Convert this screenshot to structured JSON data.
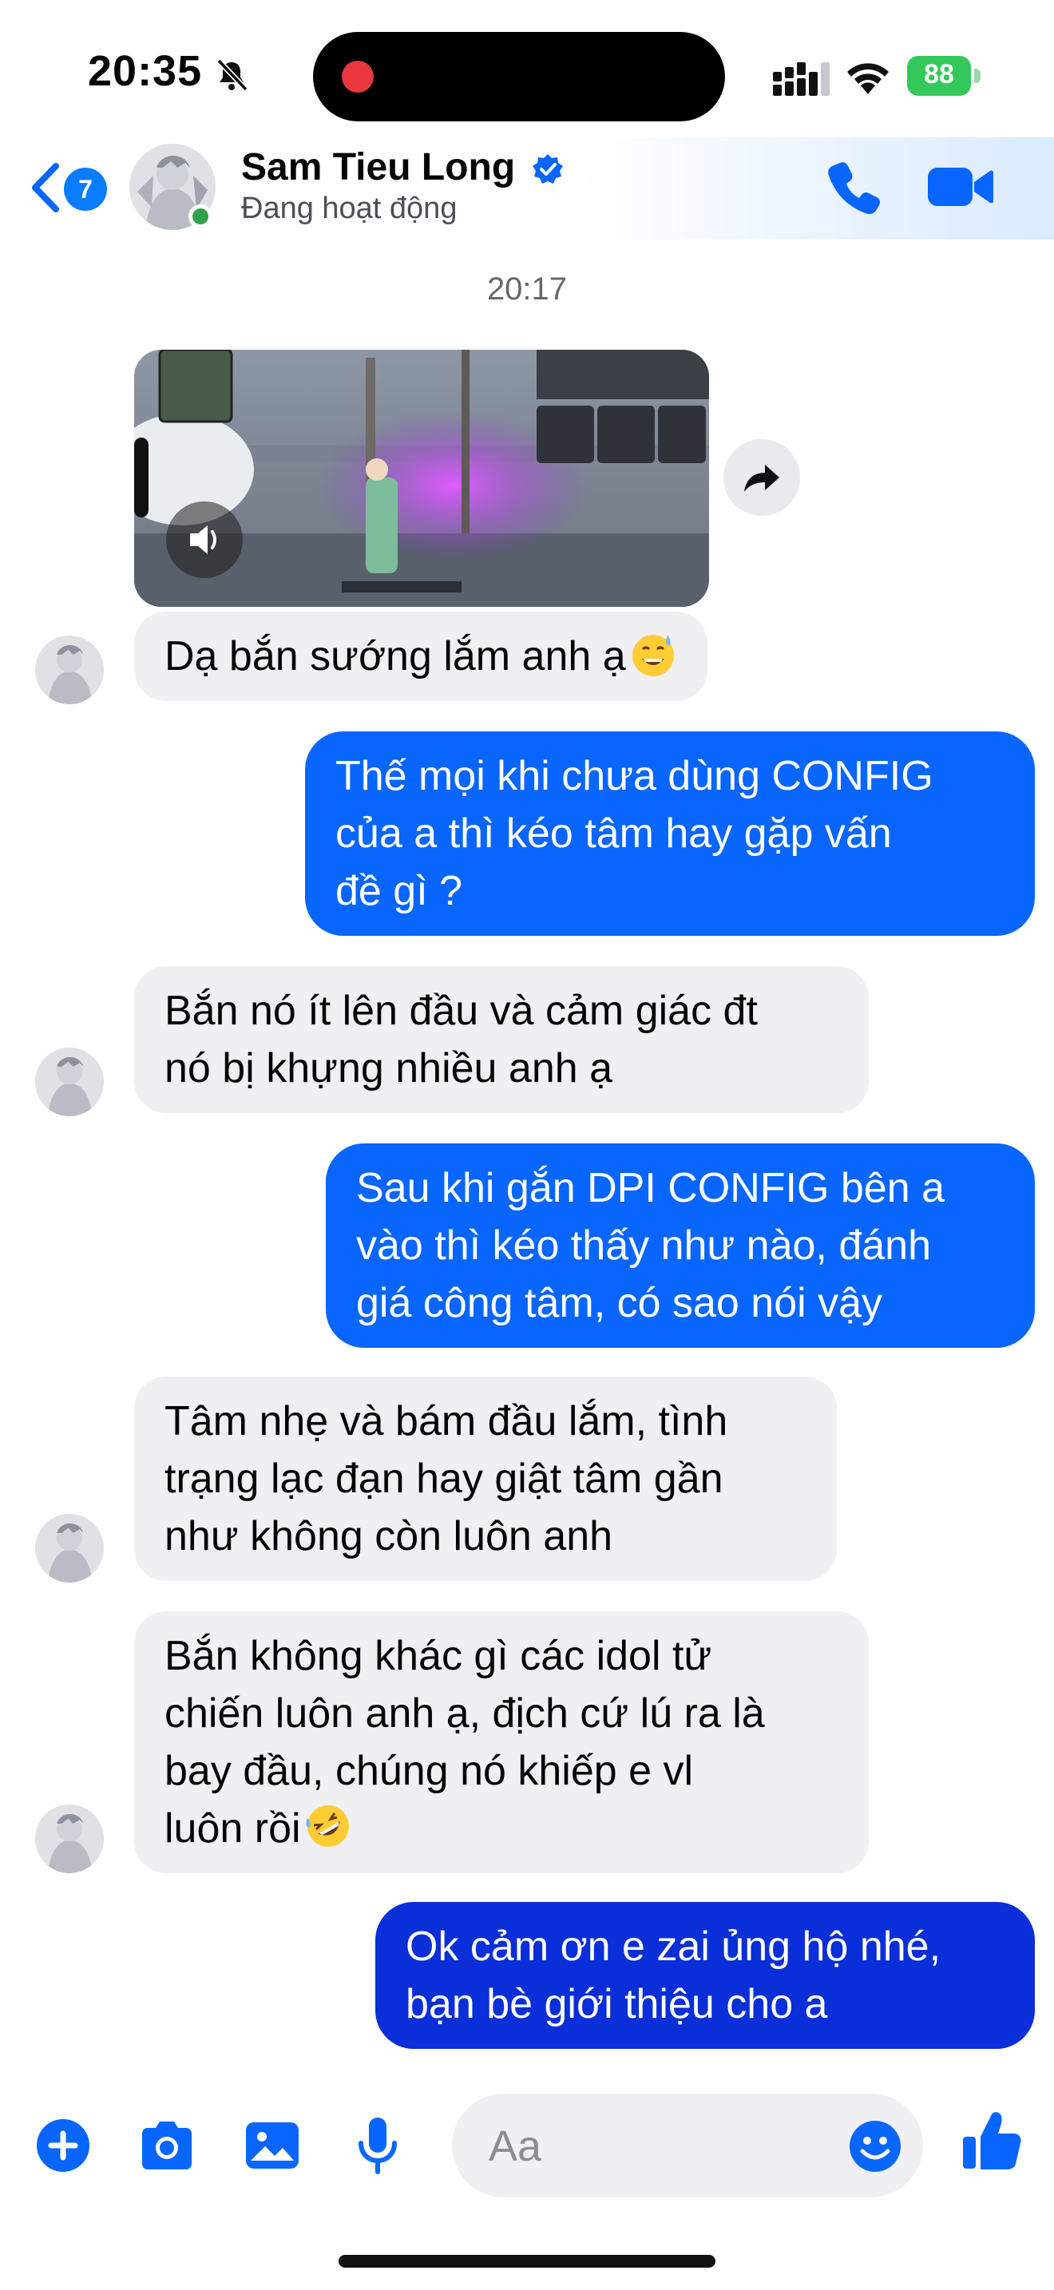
{
  "status_bar": {
    "time": "20:35",
    "battery": "88",
    "icons": [
      "bell-slash-icon",
      "recording-dot-icon",
      "cellular-signal-icon",
      "wifi-icon",
      "battery-icon"
    ]
  },
  "header": {
    "back_badge": "7",
    "contact_name": "Sam Tieu Long",
    "status": "Đang hoạt động",
    "icons": [
      "back-chevron-icon",
      "verified-badge-icon",
      "phone-icon",
      "video-camera-icon"
    ]
  },
  "conversation": {
    "timestamp": "20:17",
    "video_message": {
      "icons": [
        "volume-icon",
        "forward-icon"
      ]
    },
    "messages": [
      {
        "sender": "contact",
        "text": "Dạ bắn sướng lắm anh ạ",
        "emoji": "grinning-sweat-emoji"
      },
      {
        "sender": "me",
        "text": "Thế mọi khi chưa dùng CONFIG\ncủa a thì kéo tâm hay gặp vấn\nđề gì ?"
      },
      {
        "sender": "contact",
        "text": "Bắn nó ít lên đầu và cảm giác đt\nnó bị khựng nhiều anh ạ"
      },
      {
        "sender": "me",
        "text": "Sau khi gắn DPI CONFIG bên a\nvào thì kéo thấy như nào, đánh\ngiá công tâm, có sao nói vậy"
      },
      {
        "sender": "contact",
        "text": "Tâm nhẹ và bám đầu lắm, tình\ntrạng lạc đạn hay giật tâm gần\nnhư không còn luôn anh"
      },
      {
        "sender": "contact",
        "text": "Bắn không khác gì các idol tử\nchiến luôn anh ạ, địch cứ lú ra là\nbay đầu, chúng nó khiếp e vl\nluôn rồi",
        "emoji": "rolling-laughing-emoji"
      },
      {
        "sender": "me",
        "text": "Ok cảm ơn e zai ủng hộ nhé,\nbạn bè giới thiệu cho a"
      }
    ]
  },
  "composer": {
    "placeholder": "Aa",
    "icons": [
      "plus-icon",
      "camera-icon",
      "photo-icon",
      "microphone-icon",
      "emoji-icon",
      "thumbs-up-icon"
    ]
  },
  "colors": {
    "accent": "#0866ff",
    "outgoing_bubble": "#0866ff",
    "outgoing_bubble_last": "#0a2fd8",
    "incoming_bubble": "#f0f0f3",
    "online": "#31a24c",
    "battery": "#34c759"
  }
}
